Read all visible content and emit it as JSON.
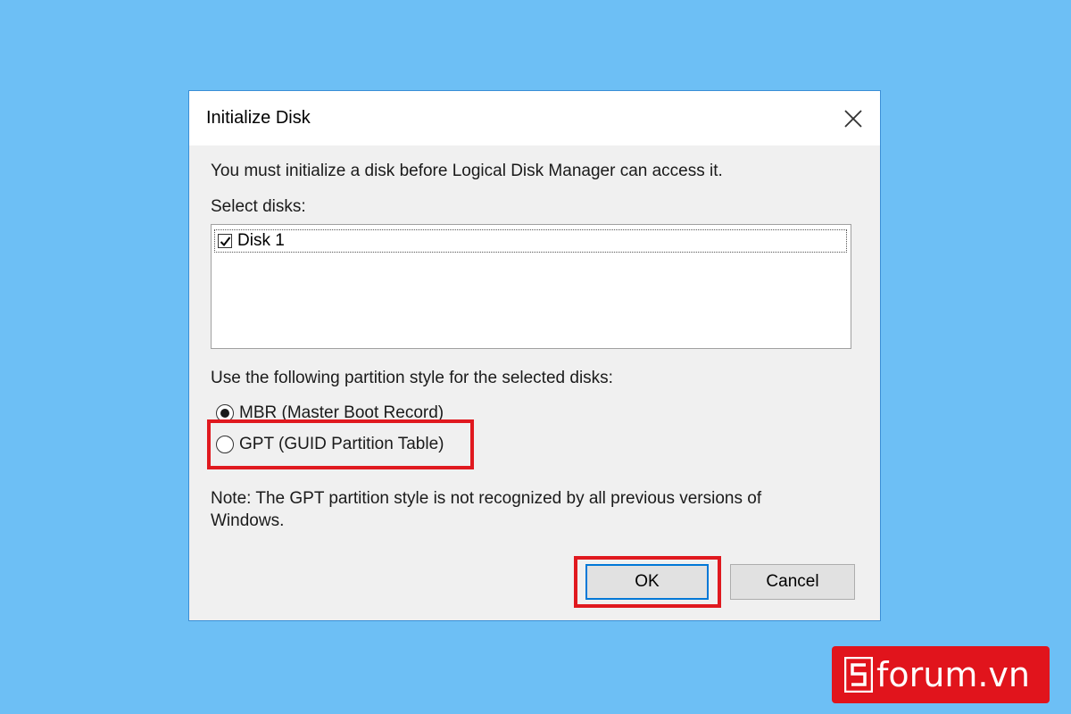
{
  "dialog": {
    "title": "Initialize Disk",
    "intro": "You must initialize a disk before Logical Disk Manager can access it.",
    "select_label": "Select disks:",
    "disks": [
      {
        "label": "Disk 1",
        "checked": true
      }
    ],
    "partition_label": "Use the following partition style for the selected disks:",
    "options": [
      {
        "label": "MBR (Master Boot Record)",
        "selected": true
      },
      {
        "label": "GPT (GUID Partition Table)",
        "selected": false
      }
    ],
    "note_line1": "Note: The GPT partition style is not recognized by all previous versions of",
    "note_line2": "Windows.",
    "ok_label": "OK",
    "cancel_label": "Cancel"
  },
  "watermark": {
    "text": "forum.vn"
  },
  "colors": {
    "background": "#6dbff5",
    "highlight": "#e0191f",
    "focus": "#0078d7",
    "brand": "#e1141c"
  }
}
